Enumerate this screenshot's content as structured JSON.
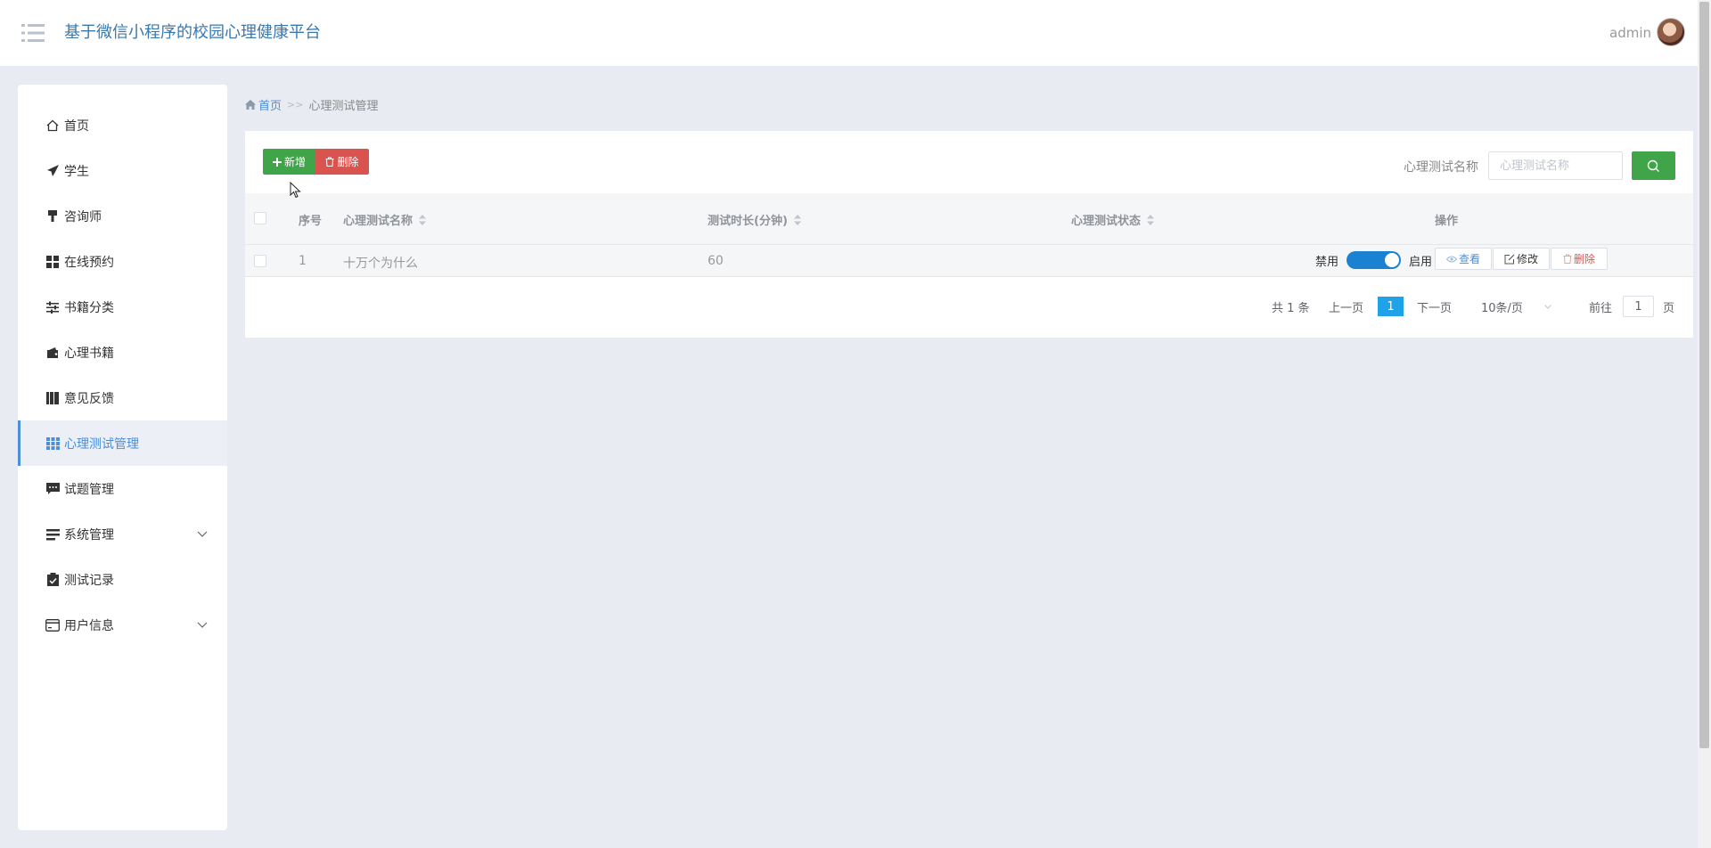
{
  "header": {
    "title": "基于微信小程序的校园心理健康平台",
    "user": "admin",
    "menu_icon": "hamburger-icon",
    "avatar_icon": "avatar"
  },
  "sidebar": {
    "items": [
      {
        "label": "首页",
        "icon": "home-icon"
      },
      {
        "label": "学生",
        "icon": "paper-plane-icon"
      },
      {
        "label": "咨询师",
        "icon": "paint-brush-icon"
      },
      {
        "label": "在线预约",
        "icon": "grid-icon"
      },
      {
        "label": "书籍分类",
        "icon": "sliders-icon"
      },
      {
        "label": "心理书籍",
        "icon": "wallet-icon"
      },
      {
        "label": "意见反馈",
        "icon": "books-icon"
      },
      {
        "label": "心理测试管理",
        "icon": "table-grid-icon",
        "active": true
      },
      {
        "label": "试题管理",
        "icon": "comment-icon"
      },
      {
        "label": "系统管理",
        "icon": "list-icon",
        "expandable": true
      },
      {
        "label": "测试记录",
        "icon": "clipboard-icon"
      },
      {
        "label": "用户信息",
        "icon": "card-icon",
        "expandable": true
      }
    ]
  },
  "breadcrumb": {
    "home": "首页",
    "separator": ">>",
    "current": "心理测试管理"
  },
  "toolbar": {
    "add_label": "新增",
    "delete_label": "删除",
    "search_label": "心理测试名称",
    "search_placeholder": "心理测试名称",
    "search_value": ""
  },
  "table": {
    "columns": [
      "序号",
      "心理测试名称",
      "测试时长(分钟)",
      "心理测试状态",
      "操作"
    ],
    "rows": [
      {
        "index": "1",
        "name": "十万个为什么",
        "duration": "60",
        "status_off": "禁用",
        "status_on": "启用",
        "enabled": true,
        "actions": {
          "view": "查看",
          "edit": "修改",
          "delete": "删除"
        }
      }
    ]
  },
  "pagination": {
    "total": "共 1 条",
    "prev": "上一页",
    "current_page": "1",
    "next": "下一页",
    "page_size": "10条/页",
    "goto_label": "前往",
    "goto_value": "1",
    "page_suffix": "页"
  },
  "colors": {
    "primary": "#4d8ed6",
    "success": "#3fa548",
    "danger": "#d9534f",
    "switch_on": "#1b82d2",
    "page_active": "#1fa2e8"
  }
}
